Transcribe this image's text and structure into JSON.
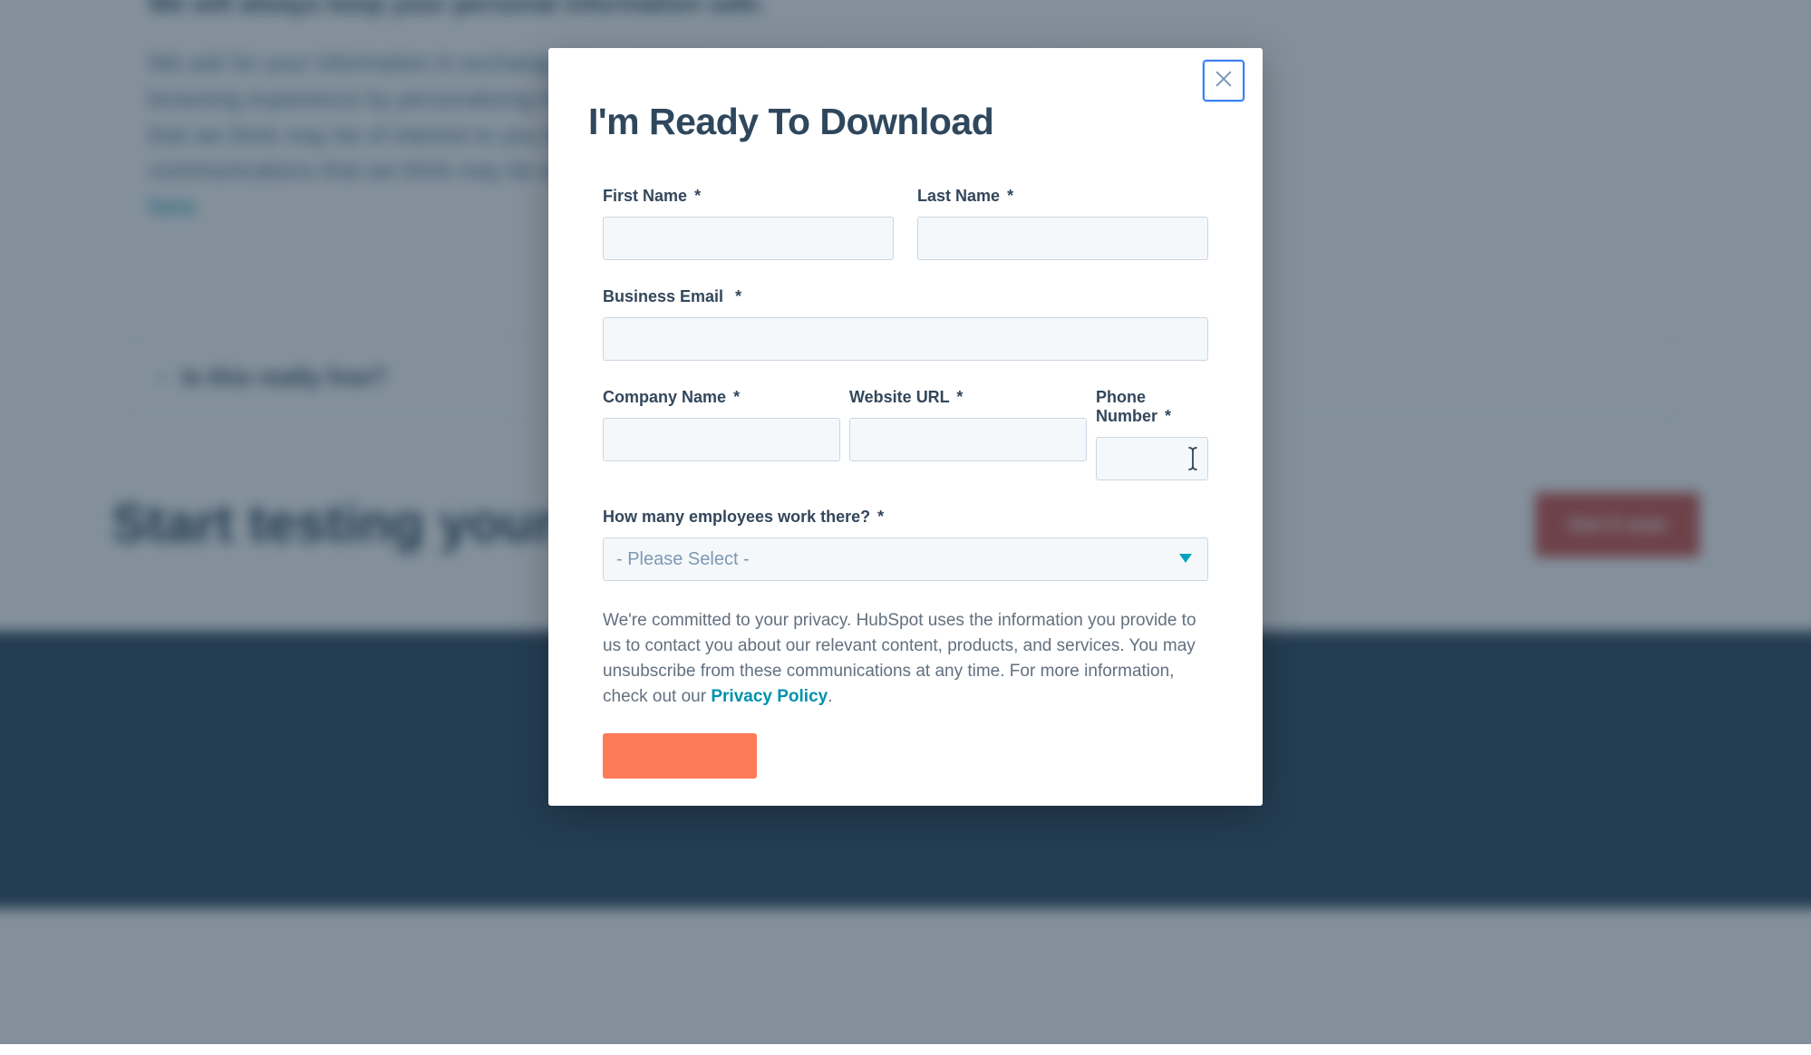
{
  "background": {
    "heading1": "We will always keep your personal information safe.",
    "paragraph_lead": "We ask for your information in exchange for a valuable resource in order to (a) improve your browsing experience by personalizing the HubSpot site to your needs; (b) send information to you that we think may be of interest to you by email or other means; (c) send you marketing communications that we think may be of value to you. You can read more about our privacy policy ",
    "paragraph_link": "here",
    "paragraph_tail": ".",
    "accordion_item": "Is this really free?",
    "cta_heading": "Start testing your landing pages today.",
    "cta_button": "Get it now"
  },
  "modal": {
    "title": "I'm Ready To Download",
    "fields": {
      "first_name": {
        "label": "First Name",
        "required": "*",
        "value": ""
      },
      "last_name": {
        "label": "Last Name",
        "required": "*",
        "value": ""
      },
      "business_email": {
        "label": "Business Email",
        "required": "*",
        "value": ""
      },
      "company_name": {
        "label": "Company Name",
        "required": "*",
        "value": ""
      },
      "website_url": {
        "label": "Website URL",
        "required": "*",
        "value": ""
      },
      "phone_number": {
        "label": "Phone Number",
        "required": "*",
        "value": ""
      },
      "employees": {
        "label": "How many employees work there?",
        "required": "*",
        "selected": "- Please Select -"
      }
    },
    "disclaimer_lead": "We're committed to your privacy. HubSpot uses the information you provide to us to contact you about our relevant content, products, and services. You may unsubscribe from these communications at any time. For more information, check out our ",
    "disclaimer_link": "Privacy Policy",
    "disclaimer_tail": ".",
    "submit_label": ""
  },
  "colors": {
    "accent": "#ff7a59",
    "link": "#0091ae",
    "heading": "#2e475d"
  }
}
